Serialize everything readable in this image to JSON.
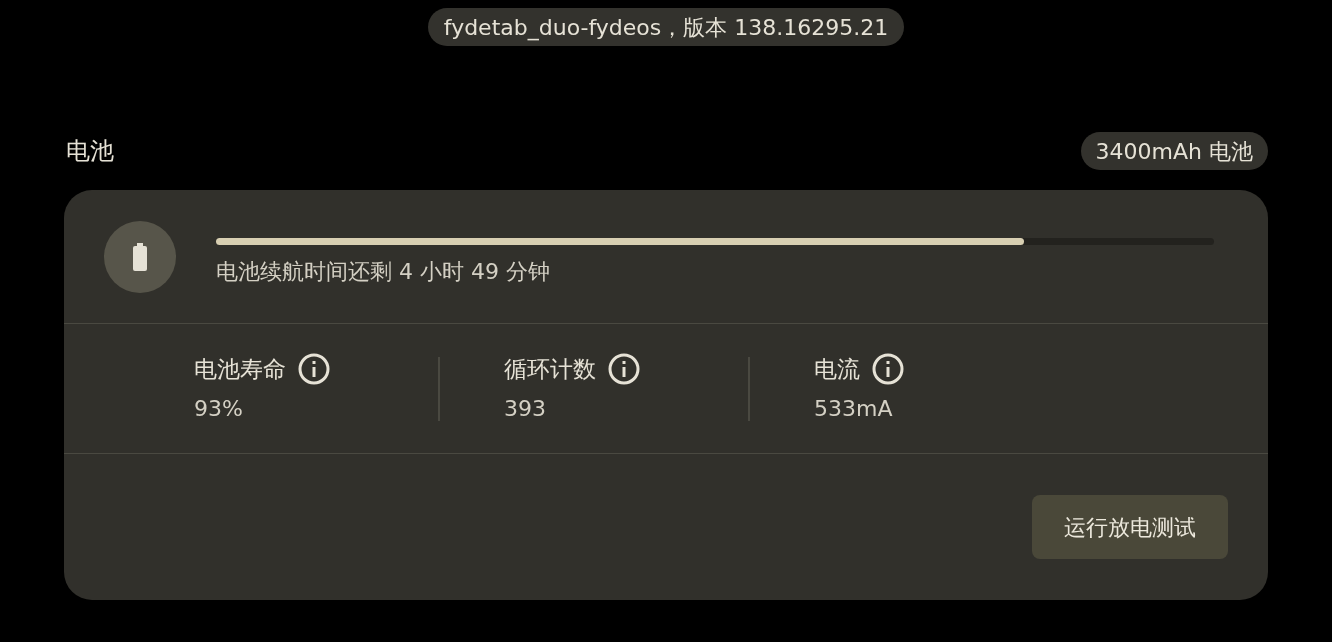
{
  "version_label": "fydetab_duo-fydeos，版本 138.16295.21",
  "section_title": "电池",
  "capacity_badge": "3400mAh 电池",
  "battery": {
    "level": 0.81,
    "status": "电池续航时间还剩 4 小时 49 分钟"
  },
  "stats": [
    {
      "label": "电池寿命",
      "value": "93%"
    },
    {
      "label": "循环计数",
      "value": "393"
    },
    {
      "label": "电流",
      "value": "533mA"
    }
  ],
  "button": "运行放电测试"
}
